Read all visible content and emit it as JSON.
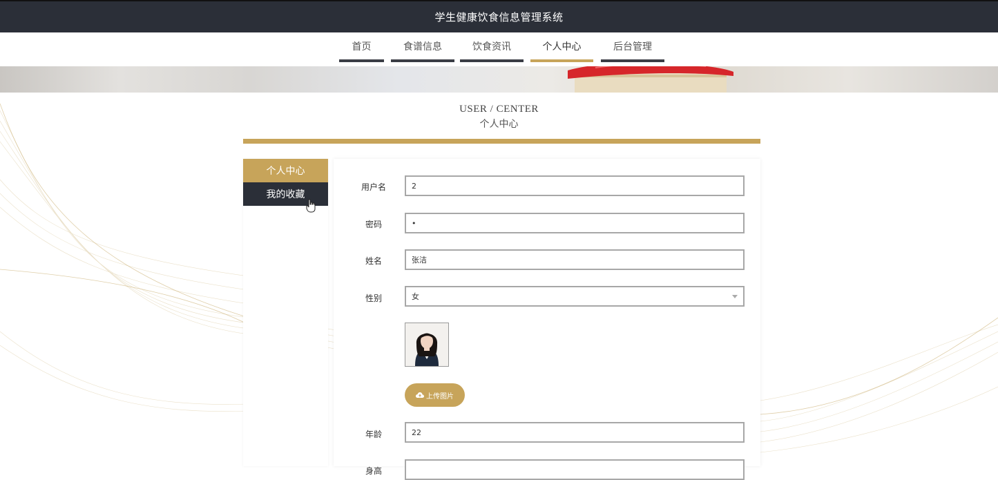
{
  "app": {
    "title": "学生健康饮食信息管理系统"
  },
  "nav": {
    "items": [
      {
        "label": "首页"
      },
      {
        "label": "食谱信息"
      },
      {
        "label": "饮食资讯"
      },
      {
        "label": "个人中心",
        "active": true
      },
      {
        "label": "后台管理"
      }
    ]
  },
  "page": {
    "title_en": "USER / CENTER",
    "title_cn": "个人中心"
  },
  "side_menu": {
    "items": [
      {
        "label": "个人中心",
        "active": true
      },
      {
        "label": "我的收藏"
      }
    ]
  },
  "form": {
    "username": {
      "label": "用户名",
      "value": "2"
    },
    "password": {
      "label": "密码",
      "value": "•"
    },
    "name": {
      "label": "姓名",
      "value": "张洁"
    },
    "gender": {
      "label": "性别",
      "value": "女"
    },
    "upload_label": "上传图片",
    "age": {
      "label": "年龄",
      "value": "22"
    },
    "next_label": "身高"
  },
  "colors": {
    "accent": "#c7a45a",
    "dark": "#2b2f38"
  },
  "icons": {
    "upload": "cloud-upload-icon",
    "select": "chevron-down-icon",
    "cursor": "hand-pointer-icon"
  }
}
